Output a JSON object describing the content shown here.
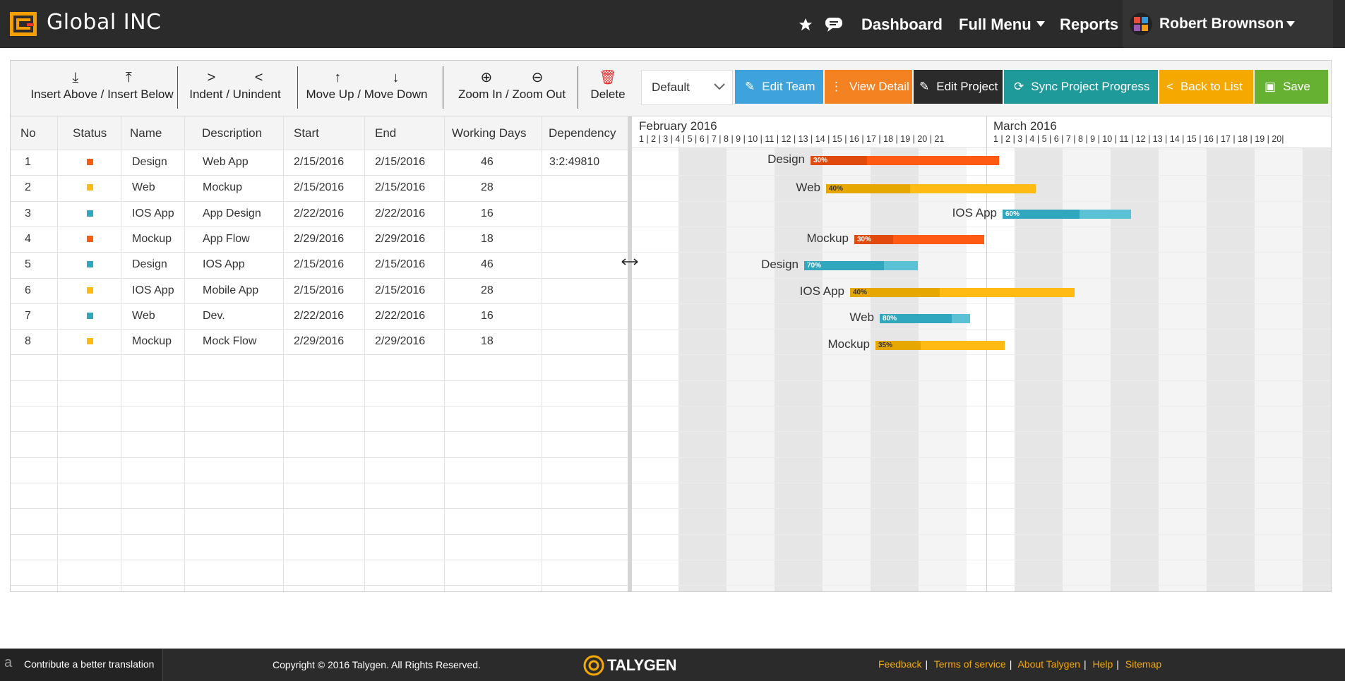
{
  "header": {
    "brand": "Global INC",
    "nav": [
      "Dashboard",
      "Full Menu",
      "Reports"
    ],
    "user": "Robert Brownson"
  },
  "toolbar": {
    "insert": "Insert Above / Insert Below",
    "indent": "Indent / Unindent",
    "move": "Move Up / Move Down",
    "zoom": "Zoom In / Zoom Out",
    "delete": "Delete",
    "view_select": "Default",
    "edit_team": "Edit Team",
    "view_detail": "View Detail",
    "edit_project": "Edit Project",
    "sync": "Sync Project Progress",
    "back": "Back to List",
    "save": "Save"
  },
  "table": {
    "columns": [
      "No",
      "Status",
      "Name",
      "Description",
      "Start",
      "End",
      "Working Days",
      "Dependency"
    ],
    "rows": [
      {
        "no": "1",
        "status_color": "#ff5a14",
        "name": "Design",
        "desc": "Web App",
        "start": "2/15/2016",
        "end": "2/15/2016",
        "days": "46",
        "dep": "3:2:49810"
      },
      {
        "no": "2",
        "status_color": "#ffba14",
        "name": "Web",
        "desc": "Mockup",
        "start": "2/15/2016",
        "end": "2/15/2016",
        "days": "28",
        "dep": ""
      },
      {
        "no": "3",
        "status_color": "#31a7bf",
        "name": "IOS App",
        "desc": "App Design",
        "start": "2/22/2016",
        "end": "2/22/2016",
        "days": "16",
        "dep": ""
      },
      {
        "no": "4",
        "status_color": "#ff5a14",
        "name": "Mockup",
        "desc": "App Flow",
        "start": "2/29/2016",
        "end": "2/29/2016",
        "days": "18",
        "dep": ""
      },
      {
        "no": "5",
        "status_color": "#31a7bf",
        "name": "Design",
        "desc": "IOS App",
        "start": "2/15/2016",
        "end": "2/15/2016",
        "days": "46",
        "dep": ""
      },
      {
        "no": "6",
        "status_color": "#ffba14",
        "name": "IOS App",
        "desc": "Mobile App",
        "start": "2/15/2016",
        "end": "2/15/2016",
        "days": "28",
        "dep": ""
      },
      {
        "no": "7",
        "status_color": "#31a7bf",
        "name": "Web",
        "desc": "Dev.",
        "start": "2/22/2016",
        "end": "2/22/2016",
        "days": "16",
        "dep": ""
      },
      {
        "no": "8",
        "status_color": "#ffba14",
        "name": "Mockup",
        "desc": "Mock Flow",
        "start": "2/29/2016",
        "end": "2/29/2016",
        "days": "18",
        "dep": ""
      }
    ]
  },
  "gantt": {
    "months": [
      "February 2016",
      "March 2016"
    ],
    "feb_days": "1 | 2 | 3 | 4 | 5 | 6 | 7 | 8 | 9 | 10 | 11 | 12 | 13 | 14 | 15 | 16 | 17 | 18 | 19 | 20 | 21",
    "mar_days": "1 | 2 | 3 | 4 | 5 | 6 | 7 | 8 | 9 | 10 | 11 | 12 | 13 | 14 | 15 | 16 | 17 | 18 | 19 | 20|",
    "bars": [
      {
        "label": "Design",
        "progress": "30%",
        "color": "#ff5a14",
        "dark": "#e04a0c"
      },
      {
        "label": "Web",
        "progress": "40%",
        "color": "#ffba14",
        "dark": "#e6a800"
      },
      {
        "label": "IOS App",
        "progress": "60%",
        "color": "#5bc2d6",
        "dark": "#31a7bf"
      },
      {
        "label": "Mockup",
        "progress": "30%",
        "color": "#ff5a14",
        "dark": "#e04a0c"
      },
      {
        "label": "Design",
        "progress": "70%",
        "color": "#5bc2d6",
        "dark": "#31a7bf"
      },
      {
        "label": "IOS App",
        "progress": "40%",
        "color": "#ffba14",
        "dark": "#e6a800"
      },
      {
        "label": "Web",
        "progress": "80%",
        "color": "#5bc2d6",
        "dark": "#31a7bf"
      },
      {
        "label": "Mockup",
        "progress": "35%",
        "color": "#ffba14",
        "dark": "#e6a800"
      }
    ]
  },
  "footer": {
    "contribute": "Contribute a better translation",
    "copyright": "Copyright © 2016 Talygen. All Rights Reserved.",
    "logo_text": "TALYGEN",
    "links": [
      "Feedback",
      "Terms of service",
      "About Talygen",
      "Help",
      "Sitemap"
    ]
  }
}
